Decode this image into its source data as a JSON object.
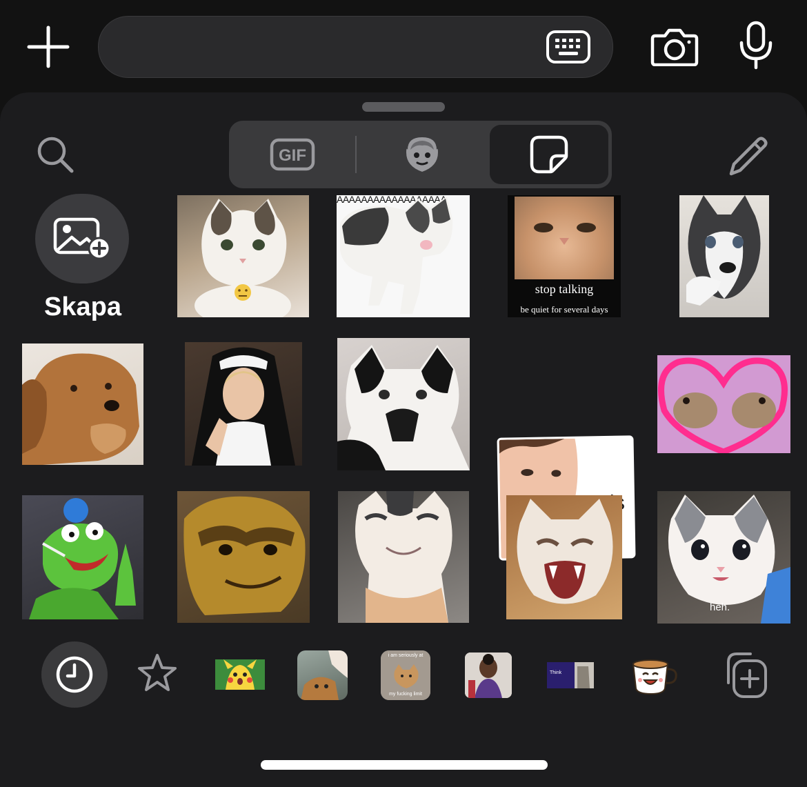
{
  "composer": {
    "input_value": "",
    "plus_icon": "plus-icon",
    "keyboard_icon": "keyboard-icon",
    "camera_icon": "camera-icon",
    "mic_icon": "microphone-icon"
  },
  "picker": {
    "tabs": [
      {
        "label": "GIF",
        "icon": "gif-icon",
        "selected": false
      },
      {
        "label": "",
        "icon": "memoji-avatar-icon",
        "selected": false
      },
      {
        "label": "",
        "icon": "sticker-icon",
        "selected": true
      }
    ],
    "search_icon": "search-icon",
    "edit_icon": "pencil-icon"
  },
  "create": {
    "label": "Skapa",
    "icon": "add-image-icon"
  },
  "stickers": [
    {
      "name": "sticker-cat-emoji",
      "caption": ""
    },
    {
      "name": "sticker-cat-screaming-aaaa",
      "caption": "AAAAAAAAAAAAAAAAAA"
    },
    {
      "name": "sticker-cat-stop-talking",
      "caption": "stop talking",
      "subcaption": "be quiet for several days"
    },
    {
      "name": "sticker-husky-pointing",
      "caption": ""
    },
    {
      "name": "sticker-dog-pondering",
      "caption": ""
    },
    {
      "name": "sticker-nun-praying",
      "caption": ""
    },
    {
      "name": "sticker-cat-gasp",
      "caption": ""
    },
    {
      "name": "sticker-sis-face",
      "caption": "sis"
    },
    {
      "name": "sticker-frogs-heart",
      "caption": ""
    },
    {
      "name": "sticker-kermit-smoking",
      "caption": ""
    },
    {
      "name": "sticker-shrek-face",
      "caption": ""
    },
    {
      "name": "sticker-cat-smiling",
      "caption": ""
    },
    {
      "name": "sticker-cat-hissing",
      "caption": ""
    },
    {
      "name": "sticker-kitten-heh",
      "caption": "heh."
    }
  ],
  "tray": [
    {
      "name": "recents",
      "icon": "clock-icon",
      "selected": true
    },
    {
      "name": "favorites",
      "icon": "star-icon"
    },
    {
      "name": "pack-surprised-pikachu",
      "icon": "sticker-pack-thumb-icon"
    },
    {
      "name": "pack-cat",
      "icon": "sticker-pack-thumb-icon"
    },
    {
      "name": "pack-seriously-cat",
      "icon": "sticker-pack-thumb-icon",
      "caption_top": "i am seriously at",
      "caption_bottom": "my fucking limit"
    },
    {
      "name": "pack-girl-meme",
      "icon": "sticker-pack-thumb-icon"
    },
    {
      "name": "pack-think-meme",
      "icon": "sticker-pack-thumb-icon",
      "caption": "Think"
    },
    {
      "name": "pack-coffee-cup",
      "icon": "sticker-pack-thumb-icon"
    },
    {
      "name": "add-sticker-pack",
      "icon": "add-sticker-icon"
    }
  ]
}
